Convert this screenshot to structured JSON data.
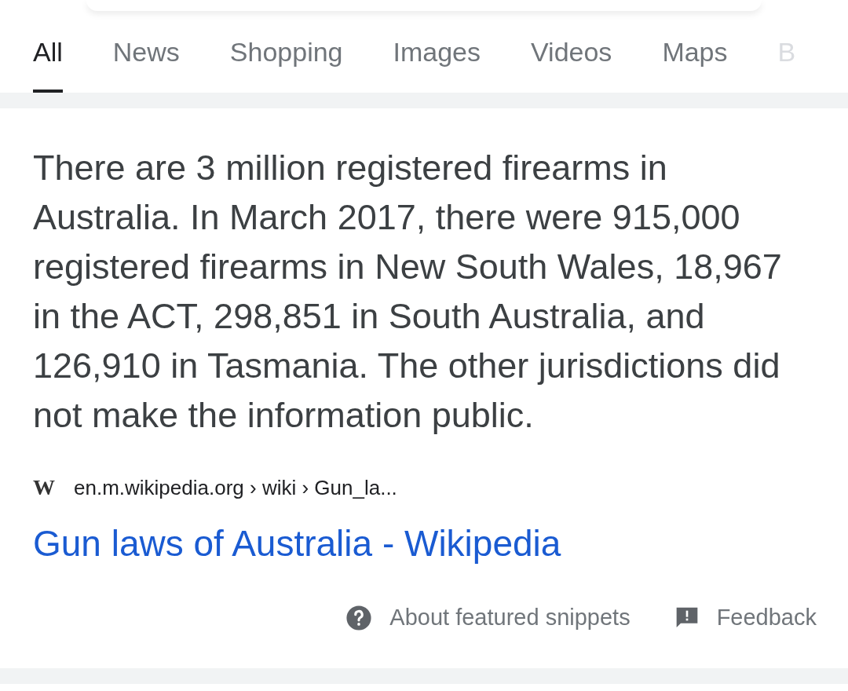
{
  "tabs": [
    {
      "label": "All",
      "selected": true
    },
    {
      "label": "News",
      "selected": false
    },
    {
      "label": "Shopping",
      "selected": false
    },
    {
      "label": "Images",
      "selected": false
    },
    {
      "label": "Videos",
      "selected": false
    },
    {
      "label": "Maps",
      "selected": false
    },
    {
      "label": "B",
      "selected": false
    }
  ],
  "snippet": {
    "text": "There are 3 million registered firearms in Australia. In March 2017, there were 915,000 registered firearms in New South Wales, 18,967 in the ACT, 298,851 in South Australia, and 126,910 in Tasmania. The other jurisdictions did not make the information public.",
    "favicon": "W",
    "breadcrumb": "en.m.wikipedia.org › wiki › Gun_la...",
    "link": "Gun laws of Australia - Wikipedia",
    "footer": [
      {
        "kind": "help",
        "label": "About featured snippets"
      },
      {
        "kind": "feedback",
        "label": "Feedback"
      }
    ]
  }
}
